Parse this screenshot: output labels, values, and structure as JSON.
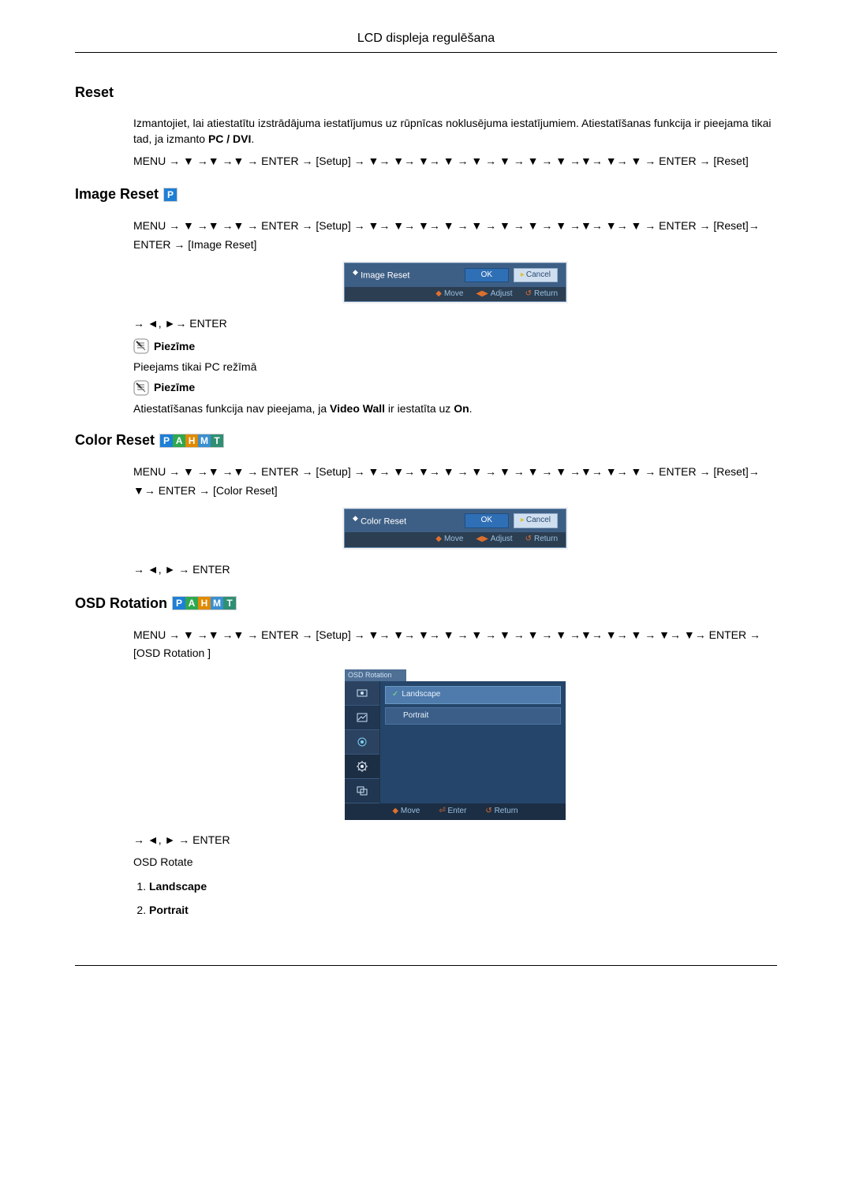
{
  "header": {
    "title": "LCD displeja regulēšana"
  },
  "icons": {
    "down": "▼",
    "left": "◄",
    "right": "►",
    "arrow": "→",
    "diamond": "◆",
    "circle": "⏎",
    "enterbox": "⏎",
    "check": "✓"
  },
  "badges": {
    "P": "P",
    "A": "A",
    "H": "H",
    "M": "M",
    "T": "T"
  },
  "sections": {
    "reset": {
      "heading": "Reset",
      "para1": "Izmantojiet, lai atiestatītu izstrādājuma iestatījumus uz rūpnīcas noklusējuma iestatījumiem. Atiestatīšanas funkcija ir pieejama tikai tad, ja izmanto ",
      "para1_bold": "PC / DVI",
      "para1_tail": ".",
      "nav": "MENU → ▼ →▼ →▼ → ENTER → [Setup] → ▼→ ▼→ ▼→ ▼ → ▼ → ▼ → ▼ → ▼ →▼→ ▼→ ▼ → ENTER → [Reset]"
    },
    "image_reset": {
      "heading": "Image Reset",
      "nav1": "MENU → ▼ →▼ →▼ → ENTER → [Setup] → ▼→ ▼→ ▼→ ▼ → ▼ → ▼ → ▼ → ▼ →▼→ ▼→ ▼ → ENTER → [Reset]→ ENTER → [Image Reset]",
      "osd": {
        "title": "Image Reset",
        "ok": "OK",
        "cancel": "Cancel",
        "footer_move": "Move",
        "footer_adjust": "Adjust",
        "footer_return": "Return"
      },
      "nav2": "→ ◄, ►→ ENTER",
      "note_label": "Piezīme",
      "note1": "Pieejams tikai PC režīmā",
      "note2_pre": "Atiestatīšanas funkcija nav pieejama, ja ",
      "note2_bold1": "Video Wall",
      "note2_mid": " ir iestatīta uz ",
      "note2_bold2": "On",
      "note2_tail": "."
    },
    "color_reset": {
      "heading": "Color Reset",
      "nav1": "MENU → ▼ →▼ →▼ → ENTER → [Setup] → ▼→ ▼→ ▼→ ▼ → ▼ → ▼ → ▼ → ▼ →▼→ ▼→ ▼ → ENTER → [Reset]→ ▼→ ENTER → [Color Reset]",
      "osd": {
        "title": "Color Reset",
        "ok": "OK",
        "cancel": "Cancel",
        "footer_move": "Move",
        "footer_adjust": "Adjust",
        "footer_return": "Return"
      },
      "nav2": "→ ◄, ► → ENTER"
    },
    "osd_rotation": {
      "heading": "OSD Rotation",
      "nav1": "MENU → ▼ →▼ →▼ → ENTER → [Setup] → ▼→ ▼→ ▼→ ▼ → ▼ → ▼ → ▼ → ▼ →▼→ ▼→ ▼ → ▼→ ▼→ ENTER → [OSD Rotation ]",
      "menu": {
        "tab": "OSD Rotation",
        "items": [
          {
            "label": "Landscape",
            "selected": true
          },
          {
            "label": "Portrait",
            "selected": false
          }
        ],
        "footer_move": "Move",
        "footer_enter": "Enter",
        "footer_return": "Return"
      },
      "nav2": "→ ◄, ► → ENTER",
      "rotate_label": "OSD Rotate",
      "options": [
        "Landscape",
        "Portrait"
      ]
    }
  }
}
